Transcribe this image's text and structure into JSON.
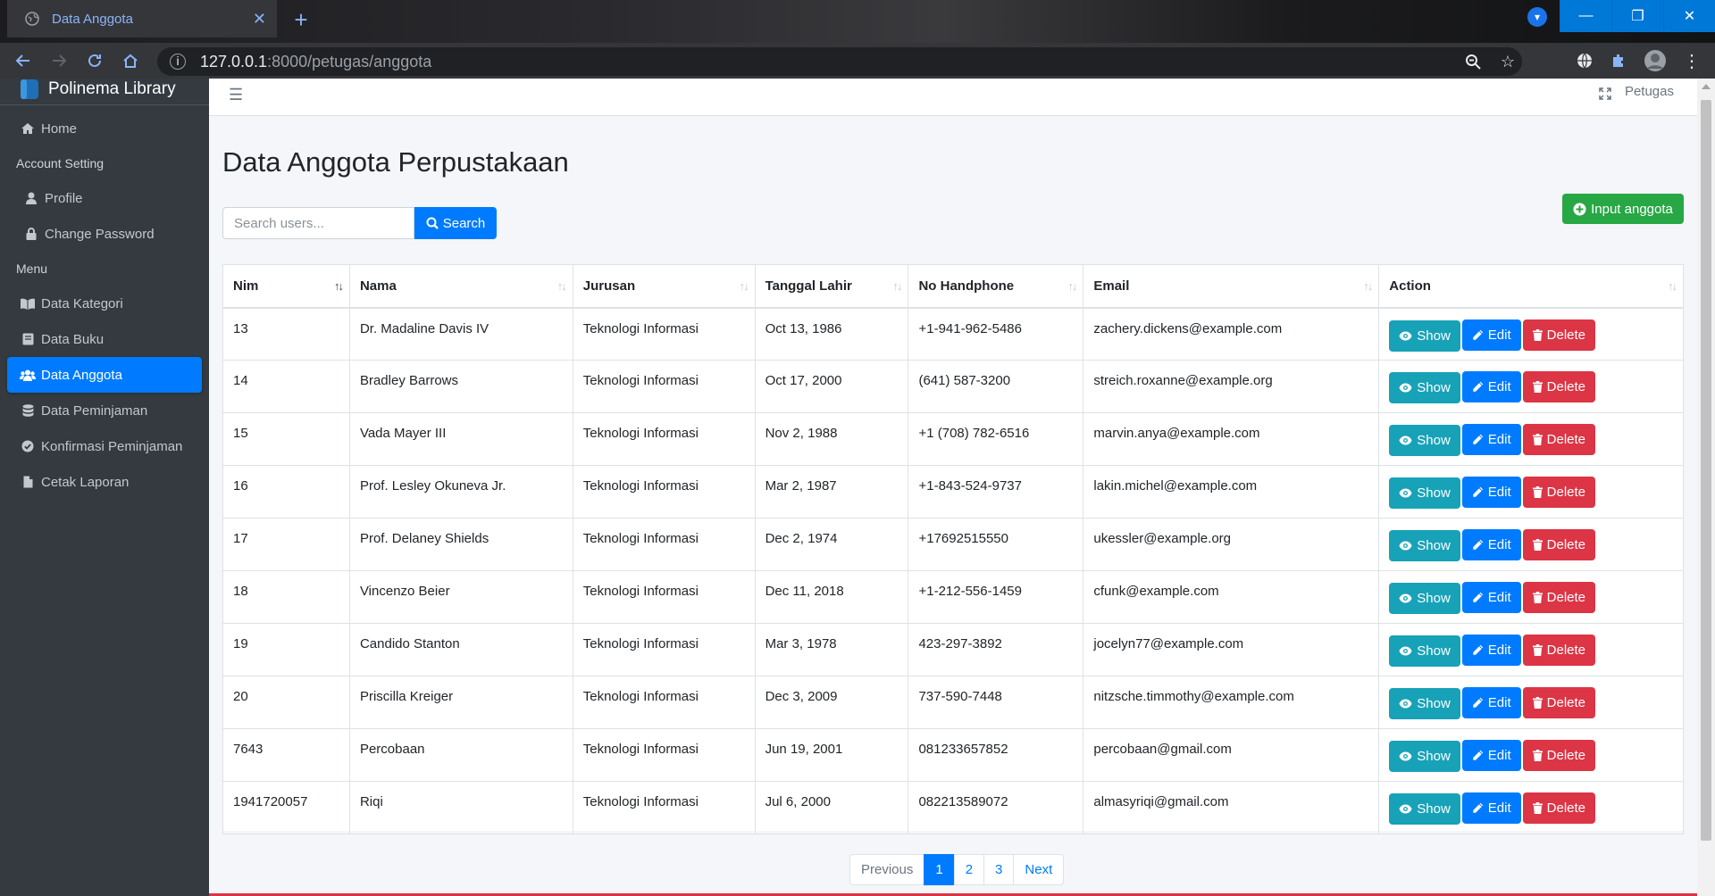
{
  "browser": {
    "tab_title": "Data Anggota",
    "url_host": "127.0.0.1",
    "url_path": ":8000/petugas/anggota"
  },
  "sidebar": {
    "brand": "Polinema Library",
    "items": [
      {
        "label": "Home",
        "icon": "home-icon",
        "type": "link"
      },
      {
        "label": "Account Setting",
        "type": "header"
      },
      {
        "label": "Profile",
        "icon": "user-icon",
        "type": "sub"
      },
      {
        "label": "Change Password",
        "icon": "lock-icon",
        "type": "sub"
      },
      {
        "label": "Menu",
        "type": "header"
      },
      {
        "label": "Data Kategori",
        "icon": "book-open-icon",
        "type": "link"
      },
      {
        "label": "Data Buku",
        "icon": "book-icon",
        "type": "link"
      },
      {
        "label": "Data Anggota",
        "icon": "users-icon",
        "type": "link",
        "active": true
      },
      {
        "label": "Data Peminjaman",
        "icon": "database-icon",
        "type": "link"
      },
      {
        "label": "Konfirmasi Peminjaman",
        "icon": "check-circle-icon",
        "type": "link"
      },
      {
        "label": "Cetak Laporan",
        "icon": "file-icon",
        "type": "link"
      }
    ]
  },
  "topnav": {
    "user_label": "Petugas"
  },
  "page": {
    "title": "Data Anggota Perpustakaan",
    "search_placeholder": "Search users...",
    "search_button": "Search",
    "input_button": "Input anggota"
  },
  "table": {
    "columns": [
      "Nim",
      "Nama",
      "Jurusan",
      "Tanggal Lahir",
      "No Handphone",
      "Email",
      "Action"
    ],
    "action_labels": {
      "show": "Show",
      "edit": "Edit",
      "delete": "Delete"
    },
    "rows": [
      [
        "13",
        "Dr. Madaline Davis IV",
        "Teknologi Informasi",
        "Oct 13, 1986",
        "+1-941-962-5486",
        "zachery.dickens@example.com"
      ],
      [
        "14",
        "Bradley Barrows",
        "Teknologi Informasi",
        "Oct 17, 2000",
        "(641) 587-3200",
        "streich.roxanne@example.org"
      ],
      [
        "15",
        "Vada Mayer III",
        "Teknologi Informasi",
        "Nov 2, 1988",
        "+1 (708) 782-6516",
        "marvin.anya@example.com"
      ],
      [
        "16",
        "Prof. Lesley Okuneva Jr.",
        "Teknologi Informasi",
        "Mar 2, 1987",
        "+1-843-524-9737",
        "lakin.michel@example.com"
      ],
      [
        "17",
        "Prof. Delaney Shields",
        "Teknologi Informasi",
        "Dec 2, 1974",
        "+17692515550",
        "ukessler@example.org"
      ],
      [
        "18",
        "Vincenzo Beier",
        "Teknologi Informasi",
        "Dec 11, 2018",
        "+1-212-556-1459",
        "cfunk@example.com"
      ],
      [
        "19",
        "Candido Stanton",
        "Teknologi Informasi",
        "Mar 3, 1978",
        "423-297-3892",
        "jocelyn77@example.com"
      ],
      [
        "20",
        "Priscilla Kreiger",
        "Teknologi Informasi",
        "Dec 3, 2009",
        "737-590-7448",
        "nitzsche.timmothy@example.com"
      ],
      [
        "7643",
        "Percobaan",
        "Teknologi Informasi",
        "Jun 19, 2001",
        "081233657852",
        "percobaan@gmail.com"
      ],
      [
        "1941720057",
        "Riqi",
        "Teknologi Informasi",
        "Jul 6, 2000",
        "082213589072",
        "almasyriqi@gmail.com"
      ]
    ]
  },
  "pagination": {
    "previous": "Previous",
    "pages": [
      "1",
      "2",
      "3"
    ],
    "current": "1",
    "next": "Next"
  },
  "colors": {
    "primary": "#007bff",
    "info": "#17a2b8",
    "danger": "#dc3545",
    "success": "#28a745",
    "sidebar": "#343a40"
  }
}
